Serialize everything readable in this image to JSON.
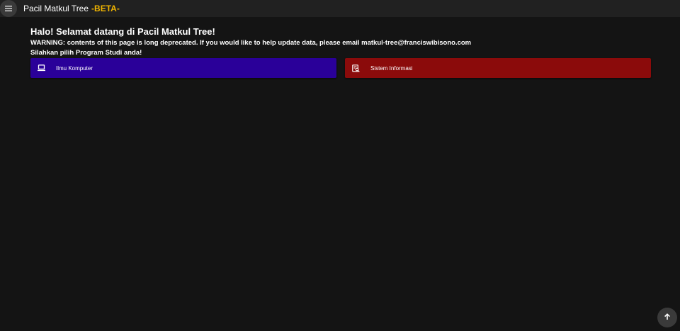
{
  "header": {
    "app_title": "Pacil Matkul Tree",
    "beta_label": "-BETA-",
    "menu_icon": "hamburger-menu-icon"
  },
  "main": {
    "greeting": "Halo! Selamat datang di Pacil Matkul Tree!",
    "warning": "WARNING: contents of this page is long deprecated. If you would like to help update data, please email matkul-tree@franciswibisono.com",
    "instruction": "Silahkan pilih Program Studi anda!",
    "programs": [
      {
        "label": "Ilmu Komputer",
        "icon": "laptop-icon",
        "color": "#2a0099"
      },
      {
        "label": "Sistem Informasi",
        "icon": "document-search-icon",
        "color": "#8b0b0b"
      }
    ]
  },
  "scroll_top": {
    "icon": "arrow-up-icon"
  },
  "colors": {
    "background": "#141414",
    "topbar": "#212121",
    "beta_accent": "#f0b400"
  }
}
